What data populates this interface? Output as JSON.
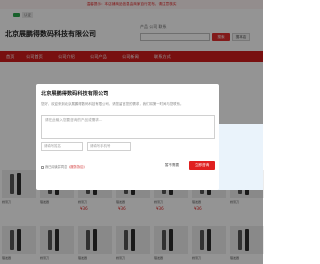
{
  "notice": "温馨提示：本店铺商品信息由商家自行发布，请注意核实",
  "brand": {
    "logo_tag": "诚信",
    "verify_tag": "认证",
    "company": "北京展鹏得数码科技有限公司"
  },
  "search": {
    "label": "产品  公司  联系",
    "placeholder": "",
    "button": "搜索",
    "button2": "搜本店"
  },
  "nav": {
    "items": [
      "首页",
      "公司首页",
      "公司介绍",
      "公司产品",
      "公司新闻",
      "联系方式"
    ]
  },
  "products": {
    "row1": [
      "剃须刀",
      "理发器",
      "剃须刀",
      "理发器",
      "剃须刀",
      "理发器",
      "剃须刀"
    ],
    "prices": [
      "¥36",
      "¥36",
      "¥36",
      "¥36"
    ],
    "row2": [
      "理发器",
      "剃须刀",
      "理发器",
      "剃须刀",
      "理发器",
      "剃须刀",
      "理发器"
    ]
  },
  "modal": {
    "title": "北京展鹏得数码科技有限公司",
    "desc": "您好，欢迎来到北京展鹏得数码科技有限公司，请您留言您的需求，我们将第一时间与您联系。",
    "textarea_placeholder": "请在此输入您要咨询的产品或需求...",
    "name_placeholder": "请填写姓名",
    "phone_placeholder": "请填写手机号",
    "agree_prefix": "我已阅读并同意",
    "agree_link": "《服务协议》",
    "skip": "暂不需要",
    "submit": "立即咨询"
  }
}
